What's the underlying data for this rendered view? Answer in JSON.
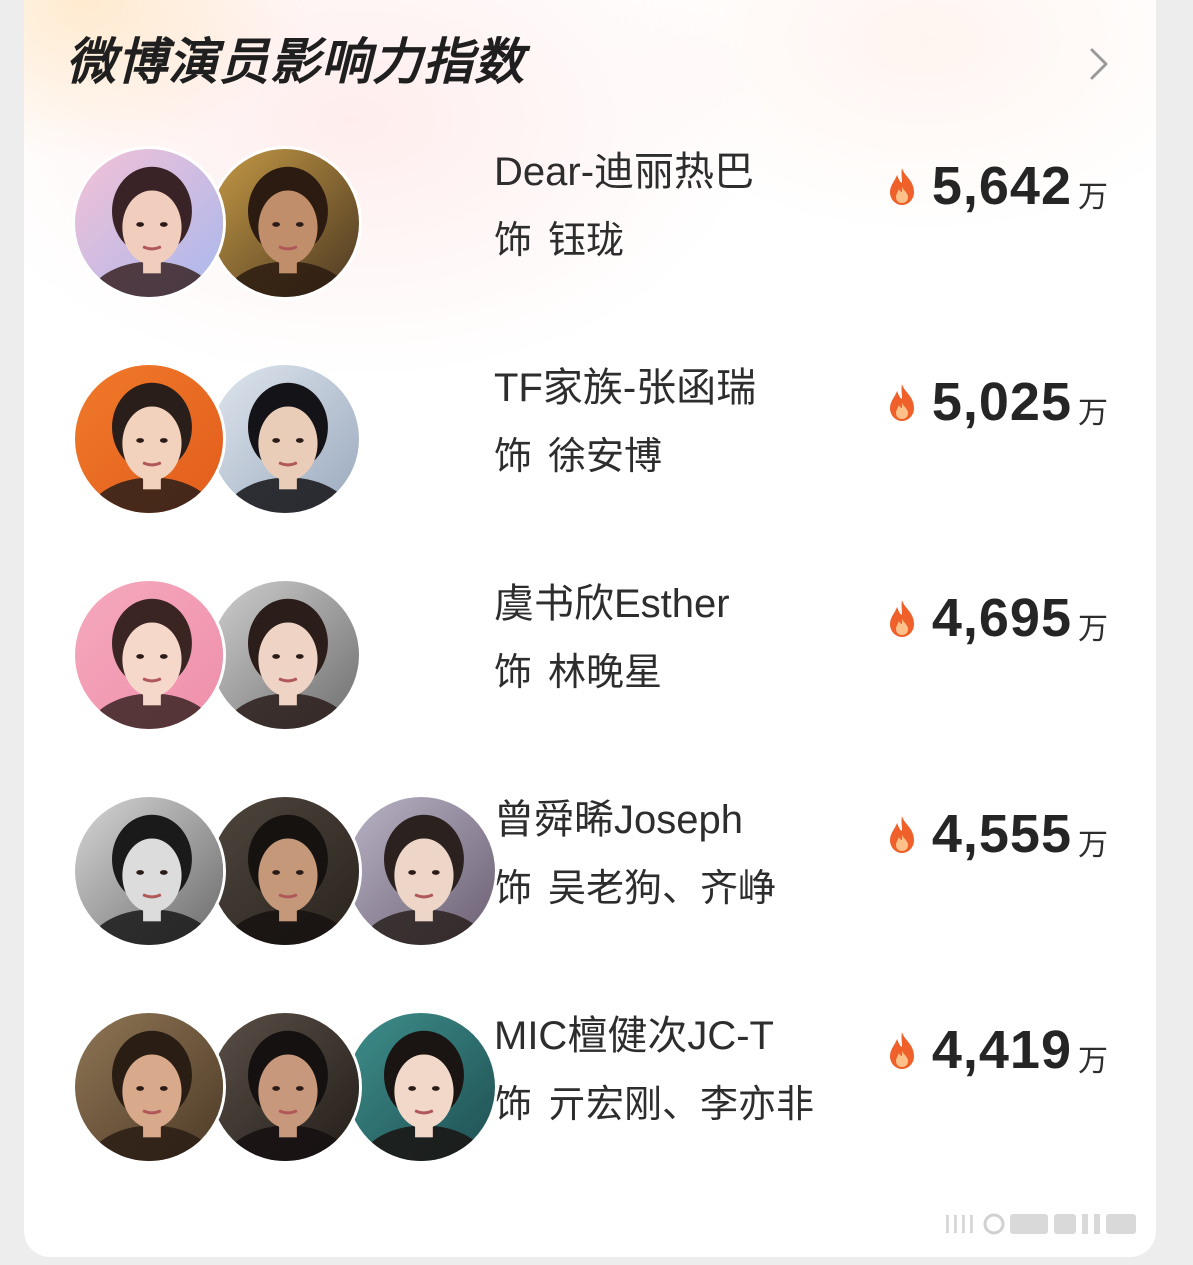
{
  "card": {
    "title": "微博演员影响力指数"
  },
  "rows": [
    {
      "name": "Dear-迪丽热巴",
      "prefix": "饰",
      "roles": "钰珑",
      "value": "5,642",
      "unit": "万",
      "avatars": [
        {
          "bg1": "#f4c1d6",
          "bg2": "#a8b8ee",
          "skin": "#f1cdbd",
          "hair": "#3a2326"
        },
        {
          "bg1": "#c59a45",
          "bg2": "#4a3722",
          "skin": "#c08e6a",
          "hair": "#2b1b10"
        }
      ]
    },
    {
      "name": "TF家族-张函瑞",
      "prefix": "饰",
      "roles": "徐安博",
      "value": "5,025",
      "unit": "万",
      "avatars": [
        {
          "bg1": "#f07a2a",
          "bg2": "#e25c1c",
          "skin": "#f3d2bd",
          "hair": "#2a1e1a"
        },
        {
          "bg1": "#dfe6ee",
          "bg2": "#9aa9bd",
          "skin": "#e9cdb8",
          "hair": "#141418"
        }
      ]
    },
    {
      "name": "虞书欣Esther",
      "prefix": "饰",
      "roles": "林晚星",
      "value": "4,695",
      "unit": "万",
      "avatars": [
        {
          "bg1": "#f5a9bd",
          "bg2": "#ef8fab",
          "skin": "#f6d8cb",
          "hair": "#3b2523"
        },
        {
          "bg1": "#cfcfcf",
          "bg2": "#6e6e6e",
          "skin": "#efd3c4",
          "hair": "#2a1d1a"
        }
      ]
    },
    {
      "name": "曾舜晞Joseph",
      "prefix": "饰",
      "roles": "吴老狗、齐峥",
      "value": "4,555",
      "unit": "万",
      "avatars": [
        {
          "bg1": "#d6d6d6",
          "bg2": "#6b6b6b",
          "skin": "#dcdcdc",
          "hair": "#1a1a1a"
        },
        {
          "bg1": "#4e463d",
          "bg2": "#2a241e",
          "skin": "#c49878",
          "hair": "#161210"
        },
        {
          "bg1": "#b9b4c6",
          "bg2": "#6b5f72",
          "skin": "#edd6c7",
          "hair": "#2b2220"
        }
      ]
    },
    {
      "name": "MIC檀健次JC-T",
      "prefix": "饰",
      "roles": "亓宏刚、李亦非",
      "value": "4,419",
      "unit": "万",
      "avatars": [
        {
          "bg1": "#8f7555",
          "bg2": "#4d3b27",
          "skin": "#d8a98a",
          "hair": "#2a1d14"
        },
        {
          "bg1": "#5b5048",
          "bg2": "#231d19",
          "skin": "#c8987c",
          "hair": "#151110"
        },
        {
          "bg1": "#3e8f8c",
          "bg2": "#1f4f52",
          "skin": "#f1d8c8",
          "hair": "#1a1412"
        }
      ]
    }
  ],
  "colors": {
    "flame_outer": "#f0602a",
    "flame_inner": "#ffc08a",
    "chevron": "#9a9a9a"
  },
  "icons": {
    "more": "chevron-right-icon",
    "heat": "flame-icon"
  }
}
